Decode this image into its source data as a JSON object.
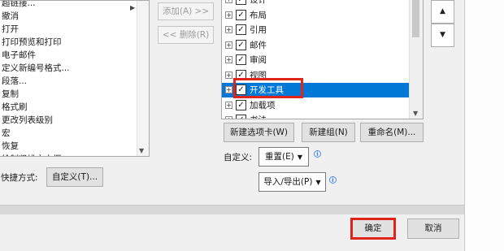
{
  "commands": {
    "items": [
      "超链接...",
      "撤消",
      "打开",
      "打印预览和打印",
      "电子邮件",
      "定义新编号格式...",
      "段落...",
      "复制",
      "格式刷",
      "更改列表级别",
      "宏",
      "恢复",
      "绘制竖排文本框"
    ]
  },
  "middle_buttons": {
    "add_label": "添加(A) >>",
    "remove_label": "<< 删除(R)"
  },
  "ribbon_tree": {
    "items": [
      {
        "label": "设计",
        "checked": true,
        "selected": false
      },
      {
        "label": "布局",
        "checked": true,
        "selected": false
      },
      {
        "label": "引用",
        "checked": true,
        "selected": false
      },
      {
        "label": "邮件",
        "checked": true,
        "selected": false
      },
      {
        "label": "审阅",
        "checked": true,
        "selected": false
      },
      {
        "label": "视图",
        "checked": true,
        "selected": false
      },
      {
        "label": "开发工具",
        "checked": true,
        "selected": true
      },
      {
        "label": "加载项",
        "checked": true,
        "selected": false
      },
      {
        "label": "书法",
        "checked": true,
        "selected": false
      }
    ]
  },
  "tab_buttons": {
    "new_tab": "新建选项卡(W)",
    "new_group": "新建组(N)",
    "rename": "重命名(M)..."
  },
  "customize": {
    "label": "自定义:",
    "reset": "重置(E)",
    "import_export": "导入/导出(P)"
  },
  "shortcut": {
    "label": "快捷方式:",
    "button": "自定义(T)..."
  },
  "footer": {
    "ok": "确定",
    "cancel": "取消"
  },
  "colors": {
    "selection": "#0078d7",
    "highlight_box": "#e0231b"
  }
}
